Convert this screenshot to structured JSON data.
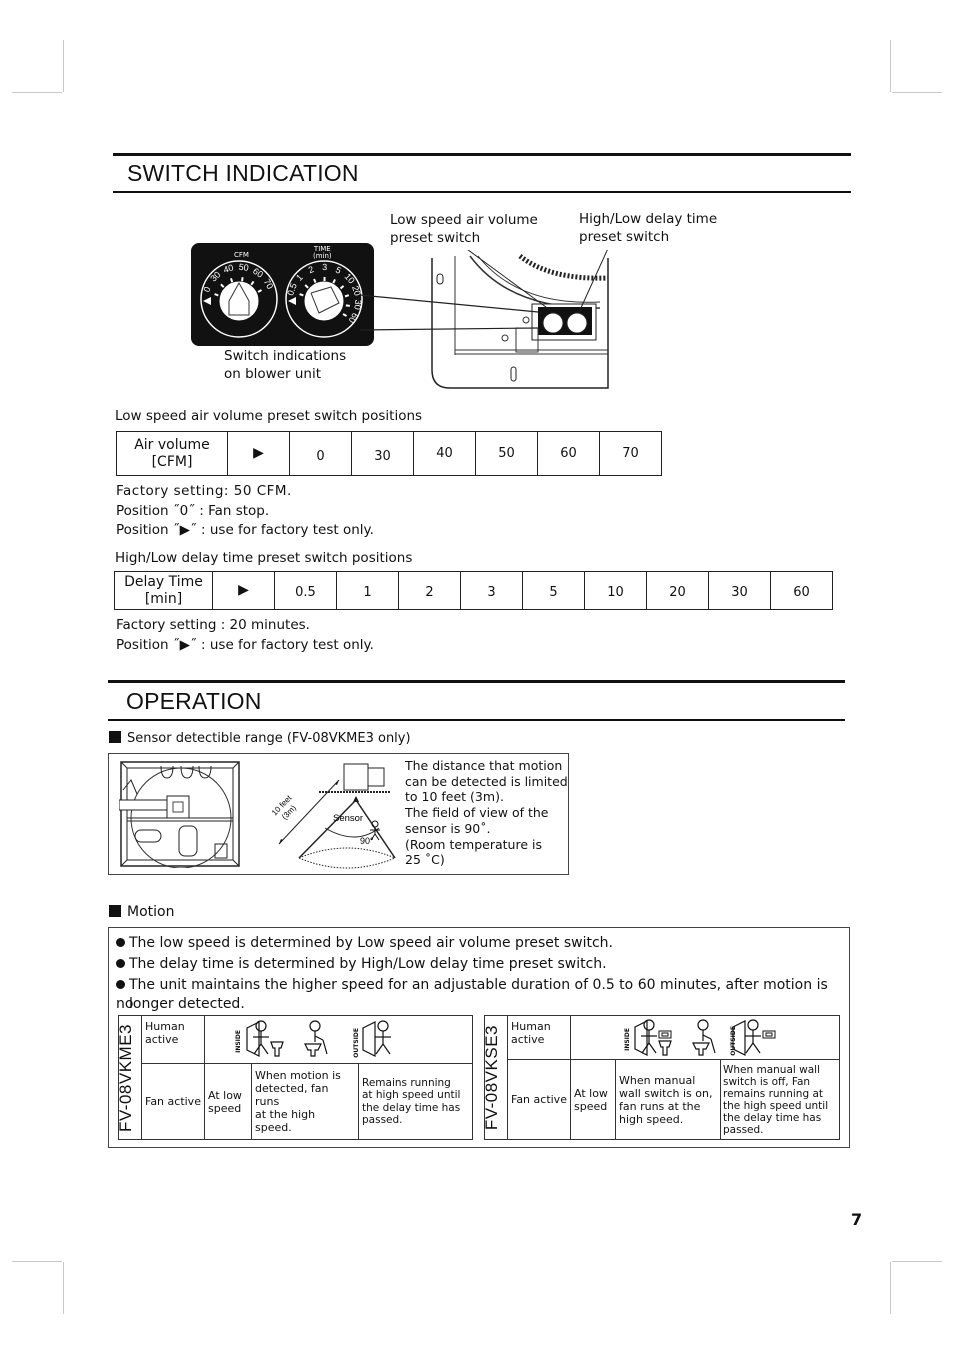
{
  "switch_indication": {
    "title": "SWITCH INDICATION",
    "callout_low": [
      "Low speed air volume",
      "preset switch"
    ],
    "callout_high": [
      "High/Low delay time",
      "preset switch"
    ],
    "caption": [
      "Switch indications",
      "on blower unit"
    ],
    "dial_cfm_label": "CFM",
    "dial_time_label": [
      "TIME",
      "(min)"
    ],
    "dial_cfm_marks": [
      "0",
      "30",
      "40",
      "50",
      "60",
      "70"
    ],
    "dial_time_marks": [
      "0.5",
      "1",
      "2",
      "3",
      "5",
      "10",
      "20",
      "30",
      "60"
    ]
  },
  "cfm_table": {
    "heading": "Low speed air volume preset switch positions",
    "header_label": [
      "Air volume",
      "[CFM]"
    ],
    "arrow": "▶",
    "values": [
      "0",
      "30",
      "40",
      "50",
      "60",
      "70"
    ],
    "notes": [
      "Factory setting: 50 CFM.",
      "Position ˝0˝ : Fan stop.",
      "Position ˝▶˝ : use for factory test only."
    ]
  },
  "delay_table": {
    "heading": "High/Low delay time preset switch positions",
    "header_label": [
      "Delay Time",
      "[min]"
    ],
    "arrow": "▶",
    "values": [
      "0.5",
      "1",
      "2",
      "3",
      "5",
      "10",
      "20",
      "30",
      "60"
    ],
    "notes": [
      "Factory setting : 20 minutes.",
      "Position ˝▶˝ : use for factory test only."
    ]
  },
  "operation": {
    "title": "OPERATION",
    "sensor_heading": "Sensor detectible range (FV-08VKME3 only)",
    "sensor_diagram": {
      "distance_label": "10 feet",
      "distance_metric": "(3m)",
      "sensor_label": "Sensor",
      "angle_label": "90°"
    },
    "sensor_text": [
      "The distance that motion",
      "can be detected is limited",
      "to 10 feet (3m).",
      "The field of view of the",
      "sensor is 90˚.",
      "(Room temperature is",
      "25 ˚C)"
    ],
    "motion_heading": "Motion",
    "bullets": [
      "The low speed is determined by Low  speed air volume preset switch.",
      "The delay time is determined by High/Low delay time preset switch.",
      "The unit maintains the higher speed for an adjustable duration of 0.5 to 60 minutes, after motion is no",
      "longer detected."
    ],
    "tables": [
      {
        "model": "FV-08VKME3",
        "human_label": [
          "Human",
          "active"
        ],
        "inside": "INSIDE",
        "outside": "OUTSIDE",
        "fan_label": "Fan active",
        "col1": [
          "At low",
          "speed"
        ],
        "col2": [
          "When motion is",
          "detected, fan runs",
          "at the high speed."
        ],
        "col3": [
          "Remains running",
          "at high speed until",
          "the delay time has",
          "passed."
        ]
      },
      {
        "model": "FV-08VKSE3",
        "human_label": [
          "Human",
          "active"
        ],
        "inside": "INSIDE",
        "outside": "OUTSIDE",
        "fan_label": "Fan active",
        "col1": [
          "At low",
          "speed"
        ],
        "col2": [
          "When manual",
          "wall switch is on,",
          "fan runs at the",
          "high speed."
        ],
        "col3": [
          "When manual wall",
          "switch is off, Fan",
          "remains running at",
          "the high speed until",
          "the delay time has",
          "passed."
        ]
      }
    ]
  },
  "page_number": "7"
}
